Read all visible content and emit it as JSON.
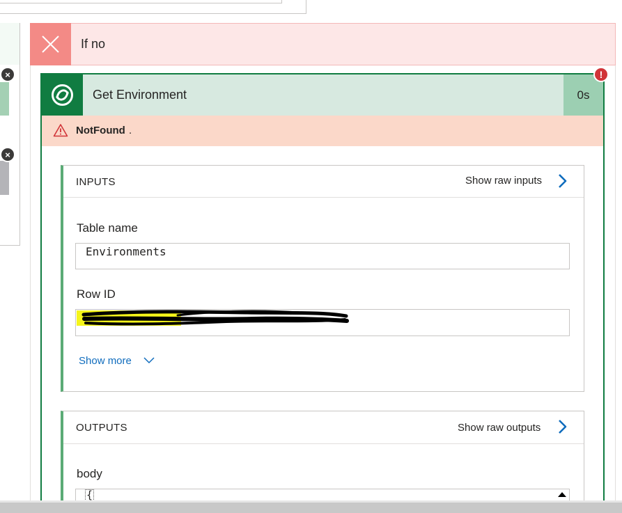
{
  "if_no": {
    "title": "If no",
    "icon": "close-icon"
  },
  "action": {
    "title": "Get Environment",
    "duration": "0s",
    "icon": "dataverse-icon",
    "status_badge": "!",
    "error": {
      "code": "NotFound",
      "suffix": ".",
      "icon": "warning-icon"
    }
  },
  "inputs": {
    "heading": "INPUTS",
    "show_raw_label": "Show raw inputs",
    "fields": {
      "table_name": {
        "label": "Table name",
        "value": "Environments"
      },
      "row_id": {
        "label": "Row ID",
        "redacted": true
      }
    },
    "show_more_label": "Show more"
  },
  "outputs": {
    "heading": "OUTPUTS",
    "show_raw_label": "Show raw outputs",
    "body": {
      "label": "body",
      "value": "{"
    }
  },
  "left_panel": {
    "close_glyph": "×"
  },
  "colors": {
    "if_no_bg": "#fde7e7",
    "if_no_icon_bg": "#f38a86",
    "action_green": "#107c41",
    "action_header_bg": "#d7e9e0",
    "duration_bg": "#9ccfb2",
    "error_bar_bg": "#fbd8c9",
    "error_badge": "#d13438",
    "link_blue": "#0f6cbd",
    "section_accent": "#5bab76"
  }
}
